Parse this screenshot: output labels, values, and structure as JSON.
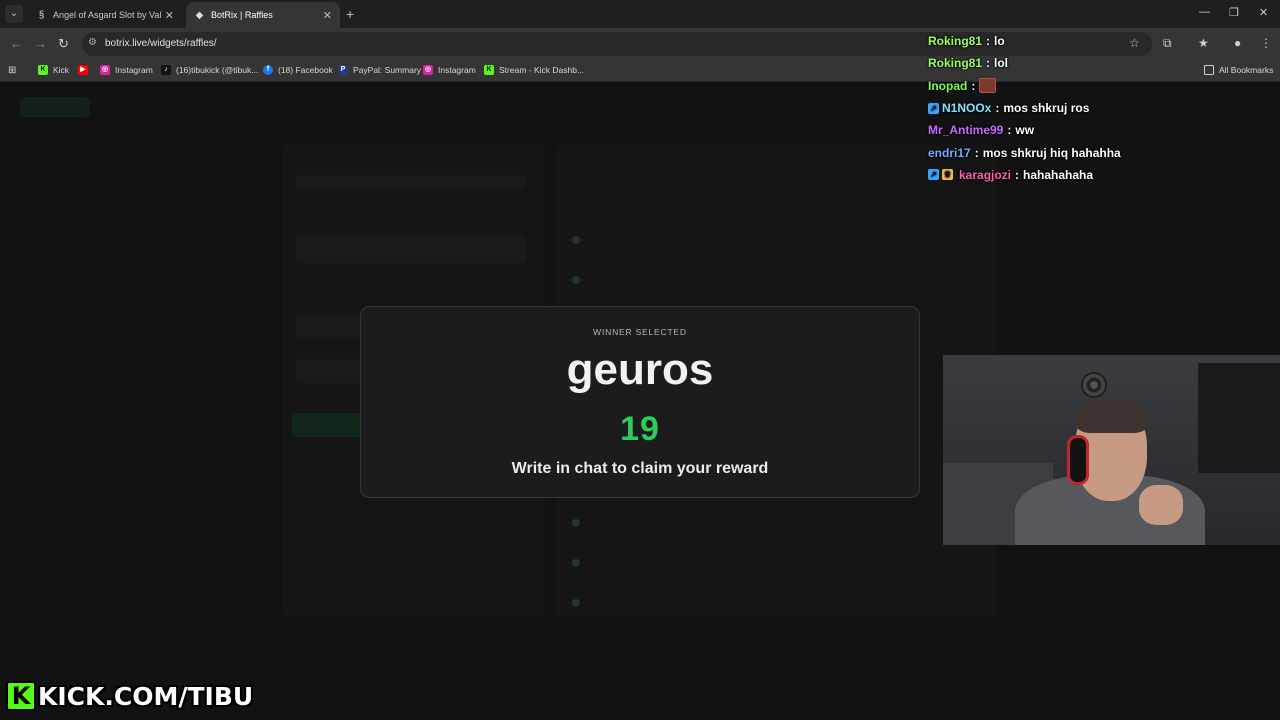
{
  "browser": {
    "tabs": [
      {
        "title": "Angel of Asgard Slot by Valkyr",
        "favicon_icon": "stake-icon",
        "active": false
      },
      {
        "title": "BotRix | Raffles",
        "favicon_icon": "botrix-icon",
        "active": true
      }
    ],
    "url": "botrix.live/widgets/raffles/",
    "bookmarks": [
      {
        "label": "Kick",
        "icon": "kick-icon",
        "color": "#53fc18"
      },
      {
        "label": "",
        "icon": "youtube-icon",
        "color": "#ff0000"
      },
      {
        "label": "Instagram",
        "icon": "instagram-icon",
        "color": "#d6249f"
      },
      {
        "label": "(16)tibukick (@tibuk...",
        "icon": "tiktok-icon",
        "color": "#111111"
      },
      {
        "label": "(18) Facebook",
        "icon": "facebook-icon",
        "color": "#1877f2"
      },
      {
        "label": "PayPal: Summary",
        "icon": "paypal-icon",
        "color": "#253b80"
      },
      {
        "label": "Instagram",
        "icon": "instagram-icon",
        "color": "#d6249f"
      },
      {
        "label": "Stream - Kick Dashb...",
        "icon": "kick-icon",
        "color": "#53fc18"
      }
    ],
    "all_bookmarks_label": "All Bookmarks"
  },
  "modal": {
    "label": "WINNER SELECTED",
    "winner": "geuros",
    "number": "19",
    "subtitle": "Write in chat to claim your reward",
    "number_color": "#2ecc5a"
  },
  "chat": [
    {
      "user": "Roking81",
      "message": "lo",
      "color": "#9cff5a",
      "badges": []
    },
    {
      "user": "Roking81",
      "message": "lol",
      "color": "#9cff5a",
      "badges": []
    },
    {
      "user": "Inopad",
      "message": "",
      "color": "#7dff4d",
      "badges": [],
      "emote": true
    },
    {
      "user": "N1NOOx",
      "message": "mos shkruj ros",
      "color": "#7ee6ff",
      "badges": [
        "boost-badge"
      ]
    },
    {
      "user": "Mr_Antime99",
      "message": "ww",
      "color": "#c46cff",
      "badges": []
    },
    {
      "user": "endri17",
      "message": "mos shkruj hiq hahahha",
      "color": "#7aa8ff",
      "badges": []
    },
    {
      "user": "karagjozi",
      "message": "hahahahaha",
      "color": "#ff5fa8",
      "badges": [
        "boost-badge",
        "crown-badge"
      ]
    }
  ],
  "brand": {
    "k": "K",
    "text": "KICK.COM/TIBU",
    "color": "#53fc18"
  }
}
